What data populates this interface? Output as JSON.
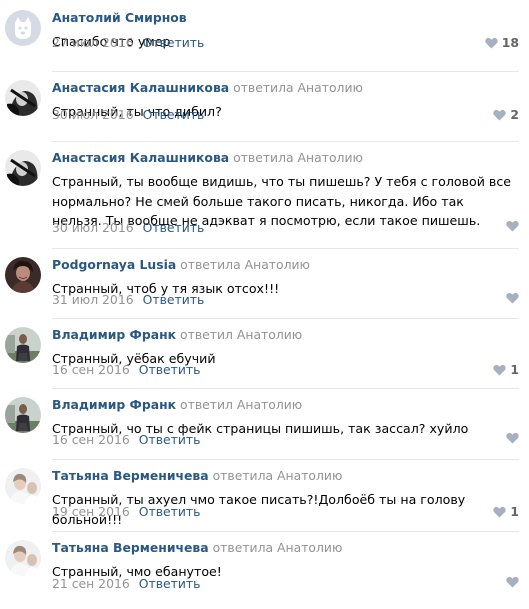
{
  "comments": [
    {
      "author": "Анатолий Смирнов",
      "reply_to": "",
      "text": "Спасибо что умер",
      "date": "27 июл 2016",
      "reply_label": "Ответить",
      "likes": "18",
      "avatar": "default-dog"
    },
    {
      "author": "Анастасия Калашникова",
      "reply_to": "ответила Анатолию",
      "text": "Странный, ты что дибил?",
      "date": "30 июл 2016",
      "reply_label": "Ответить",
      "likes": "2",
      "avatar": "bw-photo"
    },
    {
      "author": "Анастасия Калашникова",
      "reply_to": "ответила Анатолию",
      "text": "Странный, ты вообще видишь, что ты пишешь? У тебя с головой все нормально? Не смей больше такого писать, никогда. Ибо так нельзя. Ты вообще не адэкват я посмотрю, если такое пишешь.",
      "date": "30 июл 2016",
      "reply_label": "Ответить",
      "likes": "",
      "avatar": "bw-photo"
    },
    {
      "author": "Podgornaya Lusia",
      "reply_to": "ответила Анатолию",
      "text": "Странный, чтоб у тя язык отсох!!!",
      "date": "31 июл 2016",
      "reply_label": "Ответить",
      "likes": "",
      "avatar": "dark-portrait"
    },
    {
      "author": "Владимир Франк",
      "reply_to": "ответил Анатолию",
      "text": "Странный, уёбак ебучий",
      "date": "16 сен 2016",
      "reply_label": "Ответить",
      "likes": "1",
      "avatar": "outdoor-man"
    },
    {
      "author": "Владимир Франк",
      "reply_to": "ответил Анатолию",
      "text": "Странный, чо ты с фейк страницы пишишь, так зассал? хуйло",
      "date": "16 сен 2016",
      "reply_label": "Ответить",
      "likes": "",
      "avatar": "outdoor-man"
    },
    {
      "author": "Татьяна Верменичева",
      "reply_to": "ответила Анатолию",
      "text": "Странный, ты ахуел чмо такое писать?!Долбоёб ты на голову больной!!!",
      "date": "19 сен 2016",
      "reply_label": "Ответить",
      "likes": "1",
      "avatar": "light-photo"
    },
    {
      "author": "Татьяна Верменичева",
      "reply_to": "ответила Анатолию",
      "text": "Странный, чмо ебанутое!",
      "date": "21 сен 2016",
      "reply_label": "Ответить",
      "likes": "",
      "avatar": "light-photo"
    }
  ],
  "colors": {
    "author_link": "#2a5885",
    "muted": "#939393",
    "heart": "#a5b1c1",
    "divider": "#e7e8ec"
  }
}
